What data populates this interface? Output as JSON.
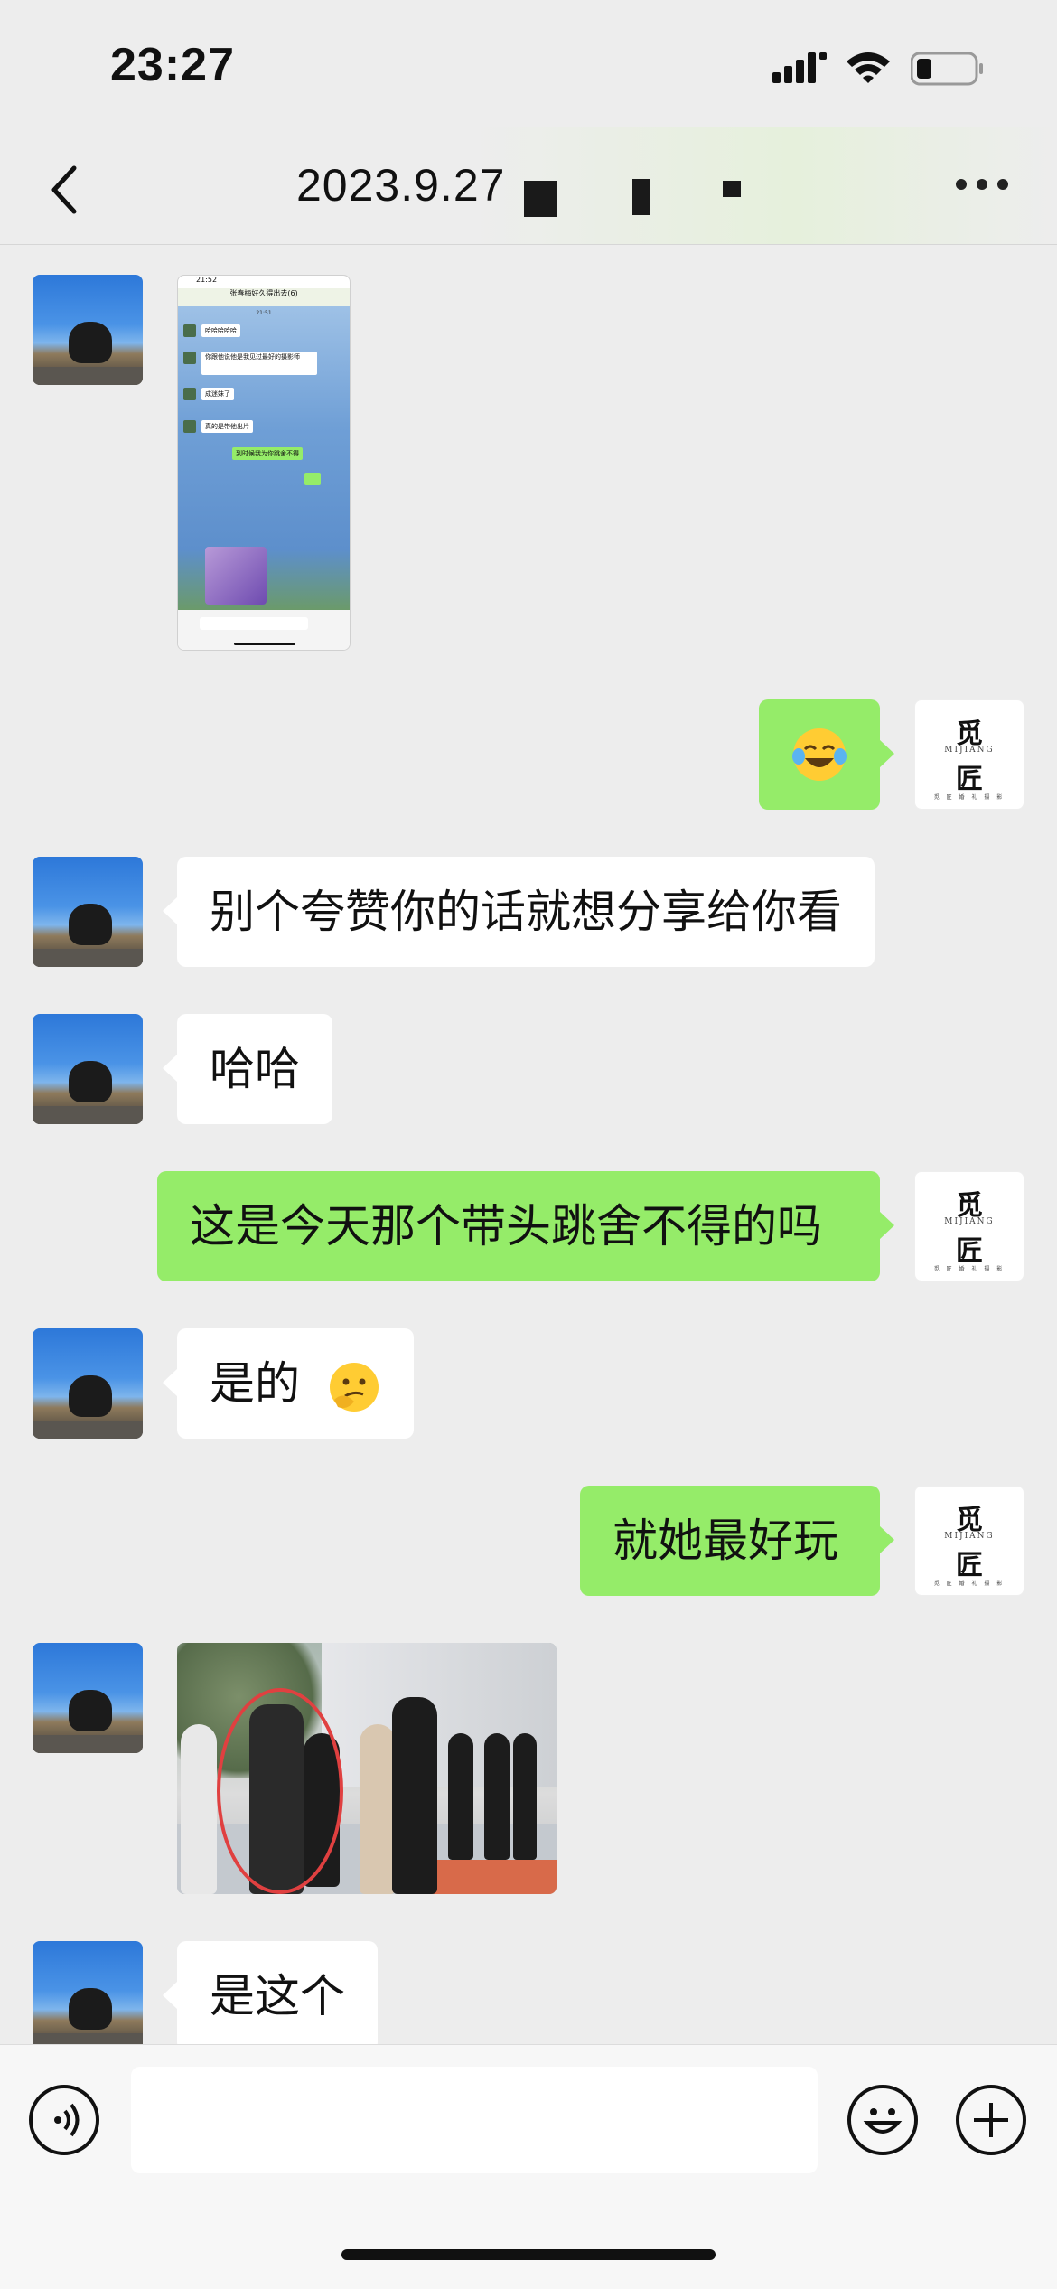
{
  "status_bar": {
    "time": "23:27"
  },
  "nav": {
    "title": "2023.9.27"
  },
  "thumbnail": {
    "time": "21:52",
    "header": "张春梅好久得出去(6)",
    "stamp": "21:51",
    "rows": [
      "哈哈哈哈哈",
      "你跟他说他是我见过最好的摄影师",
      "成迷妹了",
      "真的是带他出片"
    ],
    "green": "到时候我为你跳舍不得"
  },
  "messages": [
    {
      "side": "left",
      "kind": "image-screenshot"
    },
    {
      "side": "right",
      "kind": "emoji",
      "emoji": "tears-of-joy"
    },
    {
      "side": "left",
      "kind": "text",
      "text": "别个夸赞你的话就想分享给你看"
    },
    {
      "side": "left",
      "kind": "text",
      "text": "哈哈"
    },
    {
      "side": "right",
      "kind": "text",
      "text": "这是今天那个带头跳舍不得的吗"
    },
    {
      "side": "left",
      "kind": "text",
      "text": "是的",
      "emoji": "thinking-face"
    },
    {
      "side": "right",
      "kind": "text",
      "text": "就她最好玩"
    },
    {
      "side": "left",
      "kind": "image-photo"
    },
    {
      "side": "left",
      "kind": "text",
      "text": "是这个"
    }
  ],
  "right_avatar": {
    "line1": "觅",
    "line2": "MIJIANG",
    "line3": "匠",
    "line4": "觅 匠 婚 礼 摄 影"
  },
  "colors": {
    "bubble_green": "#95ec69",
    "bubble_white": "#ffffff",
    "background": "#ededed"
  },
  "input_bar": {
    "left_icon": "voice-icon",
    "right_icons": [
      "emoji-icon",
      "plus-icon"
    ]
  }
}
